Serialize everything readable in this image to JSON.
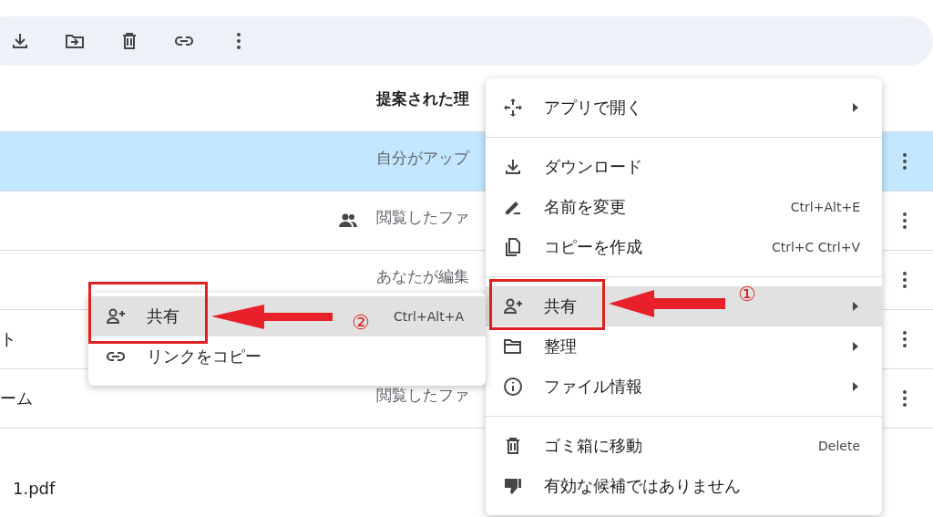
{
  "toolbar": {
    "buttons": [
      {
        "kind": "download"
      },
      {
        "kind": "move"
      },
      {
        "kind": "trash"
      },
      {
        "kind": "link"
      },
      {
        "kind": "more"
      }
    ]
  },
  "table": {
    "header": {
      "reason": "提案された理"
    },
    "rows": [
      {
        "selected": true,
        "shared": false,
        "reason": "自分がアップ"
      },
      {
        "selected": false,
        "shared": true,
        "reason": "閲覧したファ"
      },
      {
        "selected": false,
        "shared": false,
        "reason": "あなたが編集"
      },
      {
        "selected": false,
        "shared": false,
        "name": "ト"
      },
      {
        "selected": false,
        "shared": false,
        "name": "ーム",
        "reason": "閲覧したファ"
      }
    ]
  },
  "bottom_panel": {
    "file_name": "1.pdf"
  },
  "context_menu": {
    "groups": [
      [
        {
          "label": "アプリで開く",
          "has_submenu": true,
          "selected": false
        }
      ],
      [
        {
          "label": "ダウンロード",
          "has_submenu": false,
          "selected": false
        },
        {
          "label": "名前を変更",
          "shortcut": "Ctrl+Alt+E",
          "has_submenu": false,
          "selected": false
        },
        {
          "label": "コピーを作成",
          "shortcut": "Ctrl+C Ctrl+V",
          "has_submenu": false,
          "selected": false
        }
      ],
      [
        {
          "label": "共有",
          "has_submenu": true,
          "selected": true
        },
        {
          "label": "整理",
          "has_submenu": true,
          "selected": false
        },
        {
          "label": "ファイル情報",
          "has_submenu": true,
          "selected": false
        }
      ],
      [
        {
          "label": "ゴミ箱に移動",
          "shortcut": "Delete",
          "has_submenu": false,
          "selected": false
        },
        {
          "label": "有効な候補ではありません",
          "has_submenu": false,
          "selected": false
        }
      ]
    ]
  },
  "share_submenu": {
    "items": [
      {
        "label": "共有",
        "shortcut": "Ctrl+Alt+A",
        "selected": true
      },
      {
        "label": "リンクをコピー",
        "selected": false
      }
    ]
  },
  "annotations": [
    {
      "number": "①"
    },
    {
      "number": "②"
    }
  ]
}
